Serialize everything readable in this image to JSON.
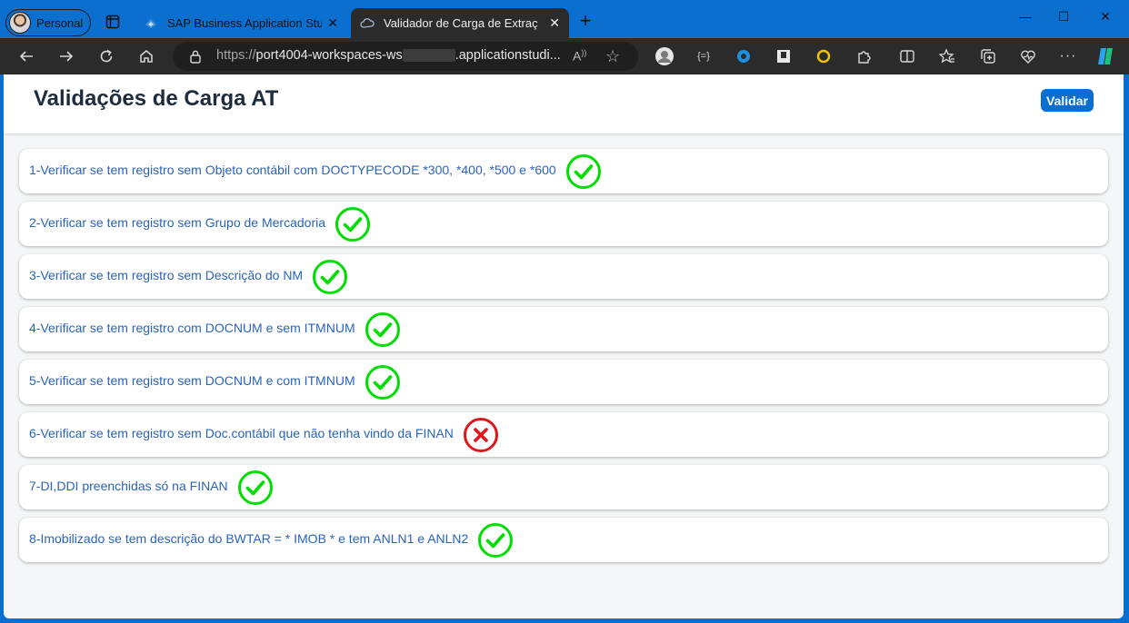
{
  "browser": {
    "profile_label": "Personal",
    "tabs": [
      {
        "title": "SAP Business Application Studio",
        "active": false
      },
      {
        "title": "Validador de Carga de Extração d",
        "active": true
      }
    ],
    "address": {
      "url_prefix": "https://",
      "url_host_start": "port4004-workspaces-ws",
      "url_host_end": ".applicationstudi...",
      "read_aloud": "A͡"
    },
    "colors": {
      "frame": "#0a6fcf",
      "toolbar": "#2b2b2b"
    }
  },
  "app": {
    "title": "Validações de Carga AT",
    "validate_button": "Validar",
    "colors": {
      "ok": "#00dd00",
      "error": "#e0161b",
      "link": "#2a63bd",
      "button": "#0a6ed1"
    },
    "checks": [
      {
        "label": "1-Verificar se tem registro sem Objeto contábil com DOCTYPECODE *300, *400, *500 e *600",
        "status": "ok",
        "icon": "check-circle-icon"
      },
      {
        "label": "2-Verificar se tem registro sem Grupo de Mercadoria",
        "status": "ok",
        "icon": "check-circle-icon"
      },
      {
        "label": "3-Verificar se tem registro sem Descrição do NM",
        "status": "ok",
        "icon": "check-circle-icon"
      },
      {
        "label": "4-Verificar se tem registro com DOCNUM e sem ITMNUM",
        "status": "ok",
        "icon": "check-circle-icon"
      },
      {
        "label": "5-Verificar se tem registro sem DOCNUM e com ITMNUM",
        "status": "ok",
        "icon": "check-circle-icon"
      },
      {
        "label": "6-Verificar se tem registro sem Doc.contábil que não tenha vindo da FINAN",
        "status": "error",
        "icon": "x-circle-icon"
      },
      {
        "label": "7-DI,DDI preenchidas só na FINAN",
        "status": "ok",
        "icon": "check-circle-icon"
      },
      {
        "label": "8-Imobilizado se tem descrição do BWTAR = * IMOB * e tem ANLN1 e ANLN2",
        "status": "ok",
        "icon": "check-circle-icon"
      }
    ]
  }
}
